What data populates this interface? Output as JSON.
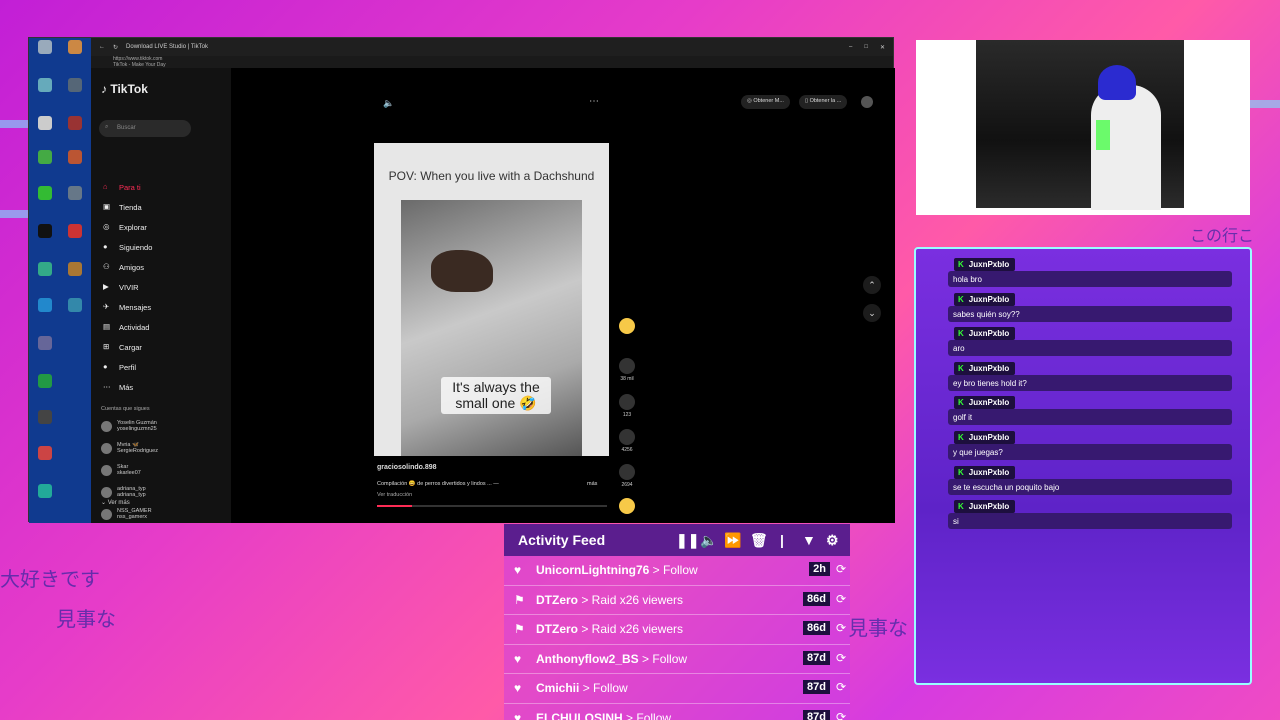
{
  "window": {
    "title": "Download LIVE Studio | TikTok",
    "url": "https://www.tiktok.com",
    "url_sub": "TikTok - Make Your Day"
  },
  "tiktok": {
    "logo": "TikTok",
    "search_placeholder": "Buscar",
    "nav": [
      "Para ti",
      "Tienda",
      "Explorar",
      "Siguiendo",
      "Amigos",
      "VIVIR",
      "Mensajes",
      "Actividad",
      "Cargar",
      "Perfil",
      "Más"
    ],
    "following_header": "Cuentas que sigues",
    "following": [
      {
        "name": "Yoselin Guzmán",
        "handle": "yoselinguzmn25"
      },
      {
        "name": "Mvria 🦋",
        "handle": "SergieRodriguez"
      },
      {
        "name": "Skar",
        "handle": "skarlee07"
      },
      {
        "name": "adriana_typ",
        "handle": "adriana_typ"
      },
      {
        "name": "NSS_GAMER",
        "handle": "nss_gamerx"
      }
    ],
    "see_more": "Ver más",
    "top_pills": [
      "Obtener M...",
      "Obtener la ..."
    ],
    "video": {
      "caption_top": "POV: When you live with a Dachshund",
      "overlay_text": "It's always the small one 🤣",
      "author": "graciosolindo.898",
      "description": "Compilación 😄 de perros divertidos y lindos ... —",
      "more": "más",
      "translate": "Ver traducción"
    },
    "actions": [
      {
        "icon": "heart-icon",
        "count": "38 mil"
      },
      {
        "icon": "comment-icon",
        "count": "123"
      },
      {
        "icon": "bookmark-icon",
        "count": "4256"
      },
      {
        "icon": "share-icon",
        "count": "2694"
      }
    ]
  },
  "chat": {
    "messages": [
      {
        "user": "JuxnPxblo",
        "text": "hola bro"
      },
      {
        "user": "JuxnPxblo",
        "text": "sabes quién soy??"
      },
      {
        "user": "JuxnPxblo",
        "text": "aro"
      },
      {
        "user": "JuxnPxblo",
        "text": "ey bro tienes hold it?"
      },
      {
        "user": "JuxnPxblo",
        "text": "golf it"
      },
      {
        "user": "JuxnPxblo",
        "text": "y que juegas?"
      },
      {
        "user": "JuxnPxblo",
        "text": "se te escucha un poquito bajo"
      },
      {
        "user": "JuxnPxblo",
        "text": "si"
      }
    ]
  },
  "feed": {
    "title": "Activity Feed",
    "rows": [
      {
        "icon": "heart-icon",
        "name": "UnicornLightning76",
        "action": "> Follow",
        "time": "2h"
      },
      {
        "icon": "raid-icon",
        "name": "DTZero",
        "action": "> Raid x26 viewers",
        "time": "86d"
      },
      {
        "icon": "raid-icon",
        "name": "DTZero",
        "action": "> Raid x26 viewers",
        "time": "86d"
      },
      {
        "icon": "heart-icon",
        "name": "Anthonyflow2_BS",
        "action": "> Follow",
        "time": "87d"
      },
      {
        "icon": "heart-icon",
        "name": "Cmichii",
        "action": "> Follow",
        "time": "87d"
      },
      {
        "icon": "heart-icon",
        "name": "ELCHULOSINH",
        "action": "> Follow",
        "time": "87d"
      }
    ]
  },
  "deco": {
    "jp1": "大好きです",
    "jp2": "見事な",
    "jp3": "見事な",
    "jp4": "この行こ"
  }
}
